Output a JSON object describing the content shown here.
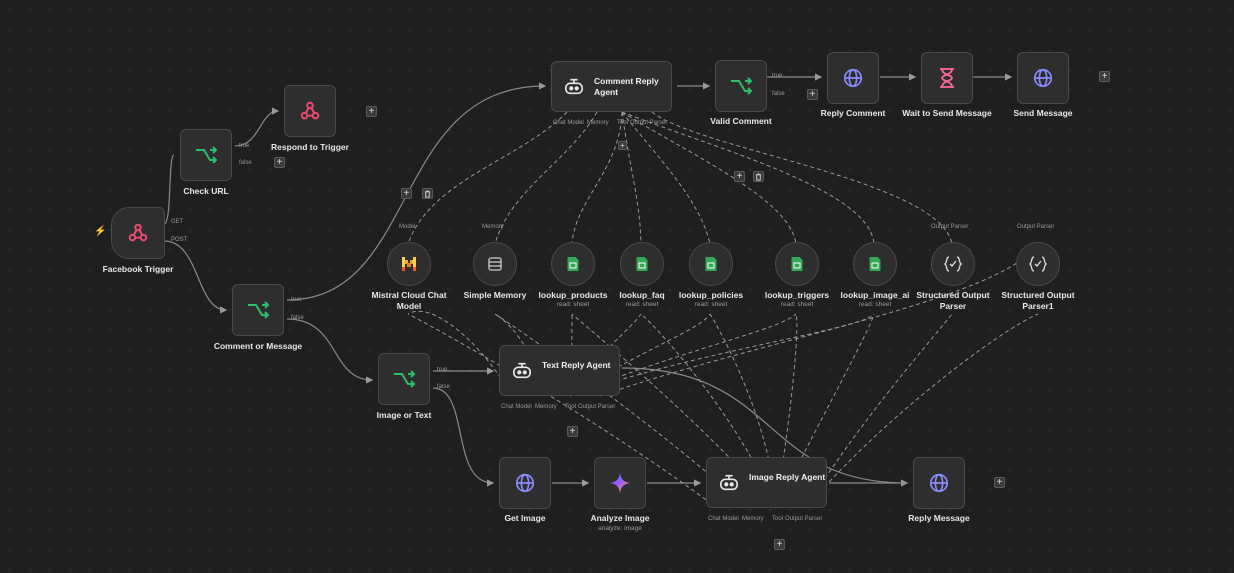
{
  "colors": {
    "canvas": "#1f1f1f",
    "node": "#2e2e2e",
    "switch_green": "#2dbe6c",
    "webhook_pink": "#ea4b71",
    "http_purple": "#8a8dff",
    "sheets_green": "#34a853",
    "wait_pink": "#ff6b9d",
    "trigger_bolt": "#ff6d3a"
  },
  "nodes": {
    "facebook_trigger": {
      "label": "Facebook Trigger",
      "icon": "webhook-icon",
      "out_get": "GET",
      "out_post": "POST"
    },
    "check_url": {
      "label": "Check URL",
      "icon": "switch-icon",
      "out_true": "true",
      "out_false": "false"
    },
    "respond_to_trigger": {
      "label": "Respond to Trigger",
      "icon": "webhook-icon"
    },
    "comment_or_message": {
      "label": "Comment or Message",
      "icon": "switch-icon",
      "out_true": "true",
      "out_false": "false"
    },
    "image_or_text": {
      "label": "Image or Text",
      "icon": "switch-icon",
      "out_true": "true",
      "out_false": "false"
    },
    "comment_reply_agent": {
      "label": "Comment Reply Agent",
      "icon": "robot-icon",
      "port1": "Chat Model",
      "port2": "Memory",
      "port3": "Tool",
      "port4": "Output Parser"
    },
    "valid_comment": {
      "label": "Valid Comment",
      "icon": "switch-icon",
      "out_true": "true",
      "out_false": "false"
    },
    "reply_comment": {
      "label": "Reply Comment",
      "icon": "globe-icon"
    },
    "wait_to_send": {
      "label": "Wait to Send Message",
      "icon": "hourglass-icon"
    },
    "send_message": {
      "label": "Send Message",
      "icon": "globe-icon"
    },
    "text_reply_agent": {
      "label": "Text Reply Agent",
      "icon": "robot-icon",
      "port1": "Chat Model",
      "port2": "Memory",
      "port3": "Tool",
      "port4": "Output Parser"
    },
    "get_image": {
      "label": "Get Image",
      "icon": "globe-icon"
    },
    "analyze_image": {
      "label": "Analyze Image",
      "sub": "analyze: image",
      "icon": "gemini-icon"
    },
    "image_reply_agent": {
      "label": "Image Reply Agent",
      "icon": "robot-icon",
      "port1": "Chat Model",
      "port2": "Memory",
      "port3": "Tool",
      "port4": "Output Parser"
    },
    "reply_message": {
      "label": "Reply Message",
      "icon": "globe-icon"
    }
  },
  "subnodes": [
    {
      "label": "Mistral Cloud Chat Model",
      "top": "Model",
      "sub": "",
      "icon": "mistral-icon"
    },
    {
      "label": "Simple Memory",
      "top": "Memory",
      "sub": "",
      "icon": "database-icon"
    },
    {
      "label": "lookup_products",
      "top": "",
      "sub": "read: sheet",
      "icon": "sheets-icon"
    },
    {
      "label": "lookup_faq",
      "top": "",
      "sub": "read: sheet",
      "icon": "sheets-icon"
    },
    {
      "label": "lookup_policies",
      "top": "",
      "sub": "read: sheet",
      "icon": "sheets-icon"
    },
    {
      "label": "lookup_triggers",
      "top": "",
      "sub": "read: sheet",
      "icon": "sheets-icon"
    },
    {
      "label": "lookup_image_ai",
      "top": "",
      "sub": "read: sheet",
      "icon": "sheets-icon"
    },
    {
      "label": "Structured Output Parser",
      "top": "Output Parser",
      "sub": "",
      "icon": "braces-icon"
    },
    {
      "label": "Structured Output Parser1",
      "top": "Output Parser",
      "sub": "",
      "icon": "braces-icon"
    }
  ],
  "controls": {
    "plus": "+"
  }
}
